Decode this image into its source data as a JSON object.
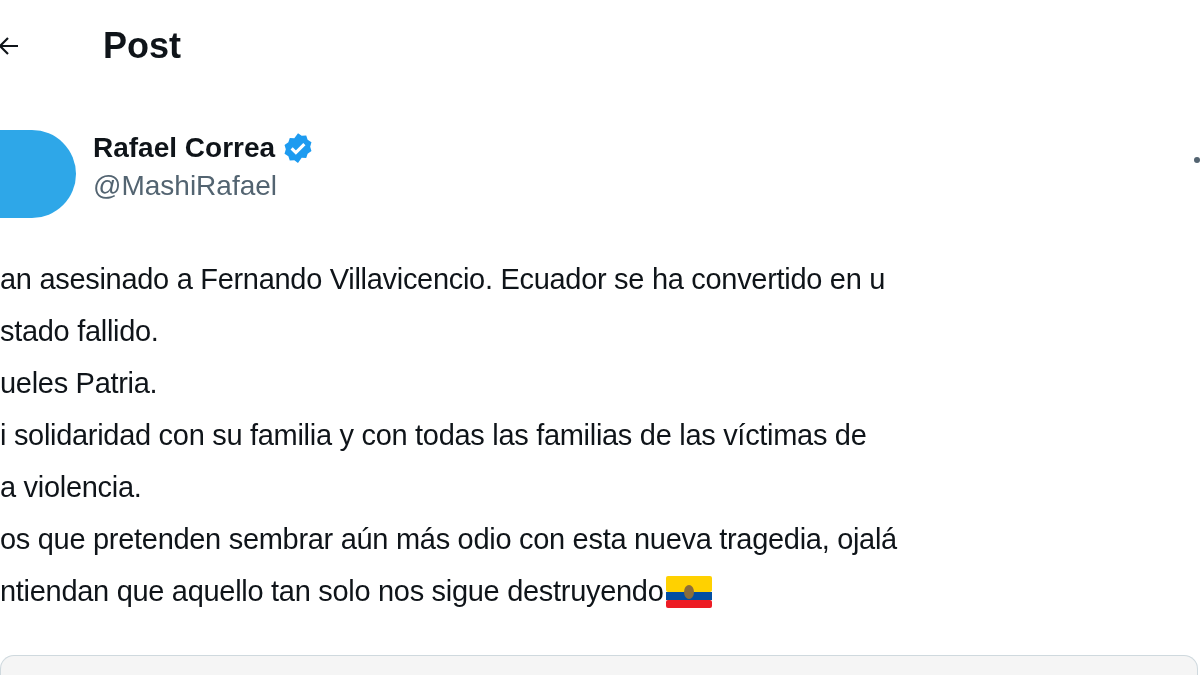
{
  "header": {
    "title": "Post"
  },
  "author": {
    "name": "Rafael Correa",
    "verified": true,
    "handle": "@MashiRafael"
  },
  "body": {
    "lines": [
      "an asesinado a Fernando Villavicencio. Ecuador se ha convertido en u",
      "stado fallido.",
      "ueles Patria.",
      "i solidaridad con su familia y con todas las familias de las víctimas de",
      "a violencia.",
      "os que pretenden sembrar aún más odio con esta nueva tragedia, ojalá",
      "ntiendan que aquello tan solo nos sigue destruyendo"
    ],
    "ends_with_flag": true
  }
}
